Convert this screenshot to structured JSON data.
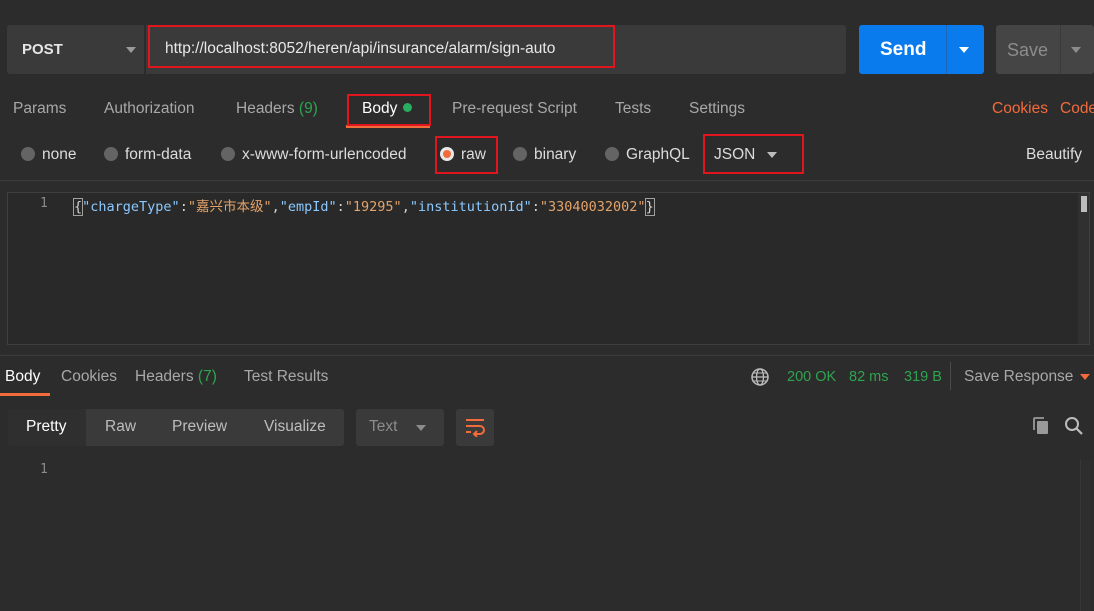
{
  "request": {
    "method": "POST",
    "url": "http://localhost:8052/heren/api/insurance/alarm/sign-auto",
    "send_label": "Send",
    "save_label": "Save"
  },
  "request_tabs": {
    "params": "Params",
    "authorization": "Authorization",
    "headers": "Headers",
    "headers_count": "(9)",
    "body": "Body",
    "prerequest": "Pre-request Script",
    "tests": "Tests",
    "settings": "Settings",
    "cookies": "Cookies",
    "code": "Code"
  },
  "body_types": {
    "none": "none",
    "form_data": "form-data",
    "urlencoded": "x-www-form-urlencoded",
    "raw": "raw",
    "binary": "binary",
    "graphql": "GraphQL",
    "selected": "raw",
    "format": "JSON",
    "beautify": "Beautify"
  },
  "editor": {
    "line_number": "1",
    "tokens": {
      "open": "{",
      "k1": "\"chargeType\"",
      "c1": ":",
      "v1": "\"嘉兴市本级\"",
      "s1": ",",
      "k2": "\"empId\"",
      "c2": ":",
      "v2": "\"19295\"",
      "s2": ",",
      "k3": "\"institutionId\"",
      "c3": ":",
      "v3": "\"33040032002\"",
      "close": "}"
    }
  },
  "response_tabs": {
    "body": "Body",
    "cookies": "Cookies",
    "headers": "Headers",
    "headers_count": "(7)",
    "test_results": "Test Results"
  },
  "response_status": {
    "status": "200 OK",
    "time": "82 ms",
    "size": "319 B",
    "save_response": "Save Response"
  },
  "response_view": {
    "pretty": "Pretty",
    "raw": "Raw",
    "preview": "Preview",
    "visualize": "Visualize",
    "format": "Text",
    "line_number": "1"
  },
  "colors": {
    "accent": "#f26b3a",
    "send": "#097bed",
    "success": "#2ea44f",
    "highlight_box": "#e0151d"
  }
}
